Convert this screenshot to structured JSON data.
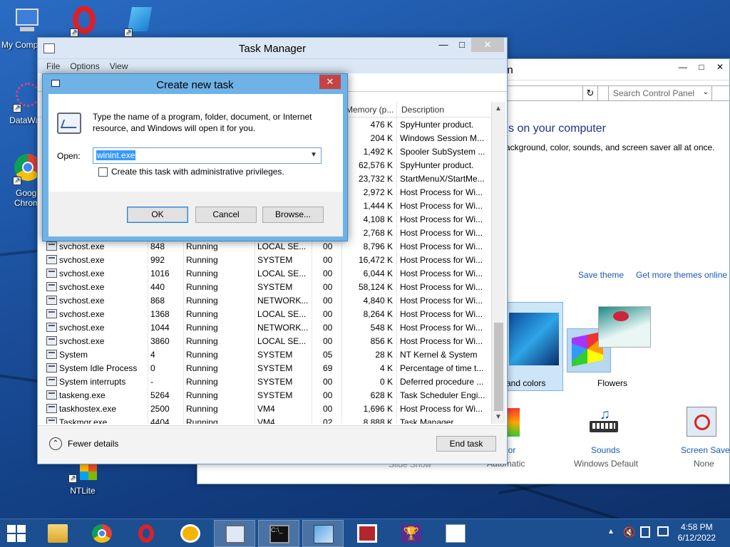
{
  "desktop": {
    "icons": [
      {
        "label": "My Comp"
      },
      {
        "label": ""
      },
      {
        "label": ""
      },
      {
        "label": "DataWag"
      },
      {
        "label": "Googl\nChrom"
      },
      {
        "label": "NTLite"
      }
    ]
  },
  "control_panel": {
    "title": "on",
    "search_placeholder": "Search Control Panel",
    "heading": "s on your computer",
    "subtext": "ackground, color, sounds, and screen saver all at once.",
    "save_theme": "Save theme",
    "get_more_themes": "Get more themes online",
    "themes": [
      {
        "label": "and colors"
      },
      {
        "label": "Flowers"
      }
    ],
    "items": [
      {
        "label": "lor",
        "sub": "Automatic"
      },
      {
        "label": "Sounds",
        "sub": "Windows Default"
      },
      {
        "label": "Screen Saver",
        "sub": "None"
      }
    ],
    "slide_show": "Slide Show"
  },
  "task_manager": {
    "title": "Task Manager",
    "menu": [
      "File",
      "Options",
      "View"
    ],
    "columns": {
      "memory": "Memory (p...",
      "description": "Description"
    },
    "rows_top": [
      {
        "memory": "476 K",
        "description": "SpyHunter product."
      },
      {
        "memory": "204 K",
        "description": "Windows Session M..."
      },
      {
        "memory": "1,492 K",
        "description": "Spooler SubSystem ..."
      },
      {
        "memory": "62,576 K",
        "description": "SpyHunter product."
      },
      {
        "memory": "23,732 K",
        "description": "StartMenuX/StartMe..."
      },
      {
        "memory": "2,972 K",
        "description": "Host Process for Wi..."
      },
      {
        "memory": "1,444 K",
        "description": "Host Process for Wi..."
      },
      {
        "memory": "4,108 K",
        "description": "Host Process for Wi..."
      },
      {
        "memory": "2,768 K",
        "description": "Host Process for Wi..."
      }
    ],
    "rows": [
      {
        "name": "svchost.exe",
        "pid": "848",
        "status": "Running",
        "user": "LOCAL SE...",
        "cpu": "00",
        "memory": "8,796 K",
        "description": "Host Process for Wi..."
      },
      {
        "name": "svchost.exe",
        "pid": "992",
        "status": "Running",
        "user": "SYSTEM",
        "cpu": "00",
        "memory": "16,472 K",
        "description": "Host Process for Wi..."
      },
      {
        "name": "svchost.exe",
        "pid": "1016",
        "status": "Running",
        "user": "LOCAL SE...",
        "cpu": "00",
        "memory": "6,044 K",
        "description": "Host Process for Wi..."
      },
      {
        "name": "svchost.exe",
        "pid": "440",
        "status": "Running",
        "user": "SYSTEM",
        "cpu": "00",
        "memory": "58,124 K",
        "description": "Host Process for Wi..."
      },
      {
        "name": "svchost.exe",
        "pid": "868",
        "status": "Running",
        "user": "NETWORK...",
        "cpu": "00",
        "memory": "4,840 K",
        "description": "Host Process for Wi..."
      },
      {
        "name": "svchost.exe",
        "pid": "1368",
        "status": "Running",
        "user": "LOCAL SE...",
        "cpu": "00",
        "memory": "8,264 K",
        "description": "Host Process for Wi..."
      },
      {
        "name": "svchost.exe",
        "pid": "1044",
        "status": "Running",
        "user": "NETWORK...",
        "cpu": "00",
        "memory": "548 K",
        "description": "Host Process for Wi..."
      },
      {
        "name": "svchost.exe",
        "pid": "3860",
        "status": "Running",
        "user": "LOCAL SE...",
        "cpu": "00",
        "memory": "856 K",
        "description": "Host Process for Wi..."
      },
      {
        "name": "System",
        "pid": "4",
        "status": "Running",
        "user": "SYSTEM",
        "cpu": "05",
        "memory": "28 K",
        "description": "NT Kernel & System"
      },
      {
        "name": "System Idle Process",
        "pid": "0",
        "status": "Running",
        "user": "SYSTEM",
        "cpu": "69",
        "memory": "4 K",
        "description": "Percentage of time t..."
      },
      {
        "name": "System interrupts",
        "pid": "-",
        "status": "Running",
        "user": "SYSTEM",
        "cpu": "00",
        "memory": "0 K",
        "description": "Deferred procedure ..."
      },
      {
        "name": "taskeng.exe",
        "pid": "5264",
        "status": "Running",
        "user": "SYSTEM",
        "cpu": "00",
        "memory": "628 K",
        "description": "Task Scheduler Engi..."
      },
      {
        "name": "taskhostex.exe",
        "pid": "2500",
        "status": "Running",
        "user": "VM4",
        "cpu": "00",
        "memory": "1,696 K",
        "description": "Host Process for Wi..."
      },
      {
        "name": "Taskmgr.exe",
        "pid": "4404",
        "status": "Running",
        "user": "VM4",
        "cpu": "02",
        "memory": "8,888 K",
        "description": "Task Manager"
      }
    ],
    "fewer_details": "Fewer details",
    "end_task": "End task"
  },
  "dialog": {
    "title": "Create new task",
    "description": "Type the name of a program, folder, document, or Internet resource, and Windows will open it for you.",
    "open_label": "Open:",
    "open_value": "winint.exe",
    "admin_label": "Create this task with administrative privileges.",
    "ok": "OK",
    "cancel": "Cancel",
    "browse": "Browse..."
  },
  "taskbar": {
    "time": "4:58 PM",
    "date": "6/12/2022"
  },
  "colors": {
    "desktop": "#1a4f9c",
    "taskbar": "#1c4f8f",
    "dialog_frame": "#6fb3e6",
    "link": "#1a5ab5"
  }
}
